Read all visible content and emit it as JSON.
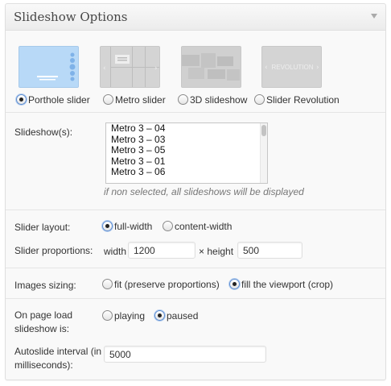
{
  "panel": {
    "title": "Slideshow Options"
  },
  "slider_types": [
    {
      "label": "Porthole slider",
      "checked": true,
      "thumb": "porthole"
    },
    {
      "label": "Metro slider",
      "checked": false,
      "thumb": "metro"
    },
    {
      "label": "3D slideshow",
      "checked": false,
      "thumb": "3d"
    },
    {
      "label": "Slider Revolution",
      "checked": false,
      "thumb": "revolution",
      "thumb_text": "REVOLUTION"
    }
  ],
  "slideshows": {
    "label": "Slideshow(s):",
    "options": [
      "Metro 3 – 04",
      "Metro 3 – 03",
      "Metro 3 – 05",
      "Metro 3 – 01",
      "Metro 3 – 06"
    ],
    "hint": "if non selected, all slideshows will be displayed"
  },
  "layout": {
    "label": "Slider layout:",
    "options": [
      {
        "label": "full-width",
        "checked": true
      },
      {
        "label": "content-width",
        "checked": false
      }
    ]
  },
  "proportions": {
    "label": "Slider proportions:",
    "width_label": "width",
    "width_value": "1200",
    "height_label": "× height",
    "height_value": "500"
  },
  "images_sizing": {
    "label": "Images sizing:",
    "options": [
      {
        "label": "fit (preserve proportions)",
        "checked": false
      },
      {
        "label": "fill the viewport (crop)",
        "checked": true
      }
    ]
  },
  "page_load": {
    "label_line1": "On page load",
    "label_line2": "slideshow is:",
    "options": [
      {
        "label": "playing",
        "checked": false
      },
      {
        "label": "paused",
        "checked": true
      }
    ]
  },
  "autoslide": {
    "label_line1": "Autoslide interval (in",
    "label_line2": "milliseconds):",
    "value": "5000"
  },
  "colors": {
    "accent": "#5a8bd1",
    "porthole_thumb": "#b8d9f7",
    "grey_thumb": "#d4d4d4"
  }
}
